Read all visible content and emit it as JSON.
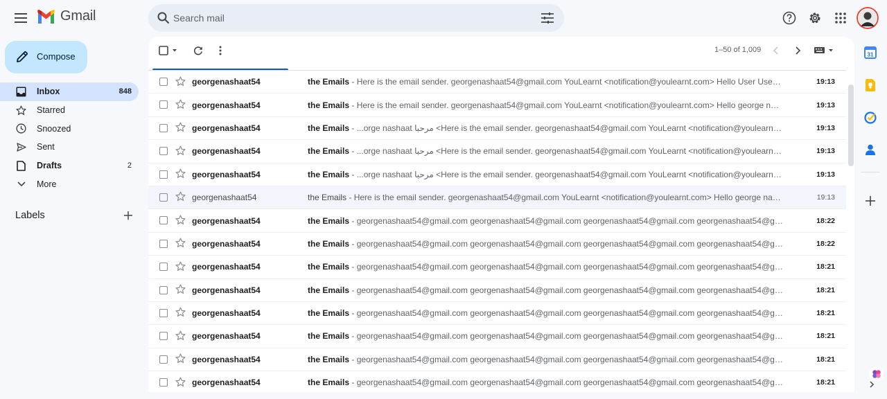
{
  "app": {
    "logo_text": "Gmail"
  },
  "search": {
    "placeholder": "Search mail"
  },
  "compose": {
    "label": "Compose"
  },
  "sidebar": {
    "items": [
      {
        "label": "Inbox",
        "count": "848",
        "icon": "inbox-icon",
        "active": true
      },
      {
        "label": "Starred",
        "count": "",
        "icon": "star-icon"
      },
      {
        "label": "Snoozed",
        "count": "",
        "icon": "clock-icon"
      },
      {
        "label": "Sent",
        "count": "",
        "icon": "send-icon"
      },
      {
        "label": "Drafts",
        "count": "2",
        "icon": "draft-icon"
      },
      {
        "label": "More",
        "count": "",
        "icon": "chevron-down-icon"
      }
    ],
    "labels_header": "Labels"
  },
  "toolbar": {
    "pager": "1–50 of 1,009"
  },
  "emails": [
    {
      "sender": "georgenashaat54",
      "subject": "the Emails",
      "snippet": "Here is the email sender. georgenashaat54@gmail.com YouLearnt <notification@youlearnt.com> Hello User User, C...",
      "time": "19:13",
      "read": false
    },
    {
      "sender": "georgenashaat54",
      "subject": "the Emails",
      "snippet": "Here is the email sender. georgenashaat54@gmail.com YouLearnt <notification@youlearnt.com> Hello george nash...",
      "time": "19:13",
      "read": false
    },
    {
      "sender": "georgenashaat54",
      "subject": "the Emails",
      "snippet": "...orge nashaat مرحبا <Here is the email sender. georgenashaat54@gmail.com YouLearnt <notification@youlearnt.com",
      "time": "19:13",
      "read": false
    },
    {
      "sender": "georgenashaat54",
      "subject": "the Emails",
      "snippet": "...orge nashaat مرحبا <Here is the email sender. georgenashaat54@gmail.com YouLearnt <notification@youlearnt.com",
      "time": "19:13",
      "read": false
    },
    {
      "sender": "georgenashaat54",
      "subject": "the Emails",
      "snippet": "...orge nashaat مرحبا <Here is the email sender. georgenashaat54@gmail.com YouLearnt <notification@youlearnt.com",
      "time": "19:13",
      "read": false
    },
    {
      "sender": "georgenashaat54",
      "subject": "the Emails",
      "snippet": "Here is the email sender. georgenashaat54@gmail.com YouLearnt <notification@youlearnt.com> Hello george nash...",
      "time": "19:13",
      "read": true
    },
    {
      "sender": "georgenashaat54",
      "subject": "the Emails",
      "snippet": "georgenashaat54@gmail.com georgenashaat54@gmail.com georgenashaat54@gmail.com georgenashaat54@gm...",
      "time": "18:22",
      "read": false
    },
    {
      "sender": "georgenashaat54",
      "subject": "the Emails",
      "snippet": "georgenashaat54@gmail.com georgenashaat54@gmail.com georgenashaat54@gmail.com georgenashaat54@gm...",
      "time": "18:22",
      "read": false
    },
    {
      "sender": "georgenashaat54",
      "subject": "the Emails",
      "snippet": "georgenashaat54@gmail.com georgenashaat54@gmail.com georgenashaat54@gmail.com georgenashaat54@gm...",
      "time": "18:21",
      "read": false
    },
    {
      "sender": "georgenashaat54",
      "subject": "the Emails",
      "snippet": "georgenashaat54@gmail.com georgenashaat54@gmail.com georgenashaat54@gmail.com georgenashaat54@gm...",
      "time": "18:21",
      "read": false
    },
    {
      "sender": "georgenashaat54",
      "subject": "the Emails",
      "snippet": "georgenashaat54@gmail.com georgenashaat54@gmail.com georgenashaat54@gmail.com georgenashaat54@gm...",
      "time": "18:21",
      "read": false
    },
    {
      "sender": "georgenashaat54",
      "subject": "the Emails",
      "snippet": "georgenashaat54@gmail.com georgenashaat54@gmail.com georgenashaat54@gmail.com georgenashaat54@gm...",
      "time": "18:21",
      "read": false
    },
    {
      "sender": "georgenashaat54",
      "subject": "the Emails",
      "snippet": "georgenashaat54@gmail.com georgenashaat54@gmail.com georgenashaat54@gmail.com georgenashaat54@gm...",
      "time": "18:21",
      "read": false
    },
    {
      "sender": "georgenashaat54",
      "subject": "the Emails",
      "snippet": "georgenashaat54@gmail.com georgenashaat54@gmail.com georgenashaat54@gmail.com georgenashaat54@gm...",
      "time": "18:21",
      "read": false
    }
  ],
  "colors": {
    "accent": "#0b57d0",
    "compose_bg": "#c2e7ff",
    "active_nav": "#d3e3fd",
    "search_bg": "#e9eef6",
    "page_bg": "#f6f8fc"
  },
  "side_panel": {
    "calendar_day": "31",
    "icons": [
      "calendar-icon",
      "keep-icon",
      "tasks-icon",
      "contacts-icon",
      "add-icon"
    ]
  }
}
